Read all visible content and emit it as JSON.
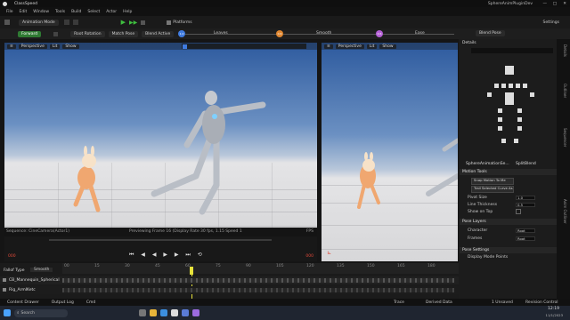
{
  "window": {
    "app_title": "SphereAnimPluginDev",
    "tab_title": "ClassSpeed",
    "controls": [
      "—",
      "□",
      "✕"
    ]
  },
  "menu": {
    "items": [
      "File",
      "Edit",
      "Window",
      "Tools",
      "Build",
      "Select",
      "Actor",
      "Help"
    ]
  },
  "toolbar": {
    "mode_label": "Animation Mode",
    "platforms_label": "Platforms",
    "settings_label": "Settings"
  },
  "sequencer_bar": {
    "forward_label": "Forward",
    "root_label": "Root Rotation",
    "match_label": "Match Pose",
    "blend_label": "Blend Active",
    "marker_1": "Leaves",
    "marker_2": "Smooth",
    "marker_3": "Ease",
    "num_1": "1.0",
    "num_2": "0.6",
    "num_3": "0.6",
    "blend_pose_label": "Blend Pose"
  },
  "viewport_left": {
    "perspective_label": "Perspective",
    "lit_label": "Lit",
    "show_label": "Show",
    "status_left": "Sequence: CineCamera(Actor1)",
    "status_center": "Previewing Frame 16 (Display Rate 30 fps, 1.15 Speed 1",
    "status_right": "FPS",
    "tb_left": "000",
    "tb_right": "000"
  },
  "viewport_right": {
    "perspective_label": "Perspective",
    "lit_label": "Lit",
    "show_label": "Show"
  },
  "right_panel": {
    "header": "Details",
    "subheader": "SphereAnimationSe...",
    "subheader_right": "SplitBlend",
    "motion_tools_label": "Motion Tools",
    "select_btn_1": "Snap Motion To Me",
    "select_btn_2": "Trail Selected Curve As",
    "prop_1_label": "Pivot Size",
    "prop_1_value": "1.0",
    "prop_2_label": "Line Thickness",
    "prop_2_value": "0.5",
    "prop_3_label": "Show on Top",
    "pose_section": "Pose Layers",
    "pose_1_label": "Character",
    "pose_1_value": "Root",
    "pose_2_label": "Frames",
    "pose_2_value": "Root",
    "pose_settings": "Pose Settings",
    "pose_settings_item": "Display Mode Points"
  },
  "side_tabs": [
    "Details",
    "Outliner",
    "Sequencer",
    "Anim Outliner"
  ],
  "timeline": {
    "filter_label": "Fallof Type",
    "filter_value": "Smooth",
    "track_1": "CB_Mannequin_Spherical",
    "track_2": "Rig_ArmIKetc",
    "ticks": [
      "00",
      "15",
      "30",
      "45",
      "60",
      "75",
      "90",
      "105",
      "120",
      "135",
      "150",
      "165",
      "180"
    ]
  },
  "status_bar": {
    "content_drawer": "Content Drawer",
    "output_log": "Output Log",
    "cmd": "Cmd",
    "trace": "Trace",
    "derived_data": "Derived Data",
    "unsaved": "1 Unsaved",
    "revision": "Revision Control"
  },
  "taskbar": {
    "search_placeholder": "Search",
    "time": "12:19",
    "date": "11/1/2023"
  },
  "colors": {
    "accent_green": "#2f7a33",
    "marker_blue": "#3f7be0",
    "marker_orange": "#e0862f",
    "marker_purple": "#b45fd6",
    "playhead": "#e6e23a"
  }
}
